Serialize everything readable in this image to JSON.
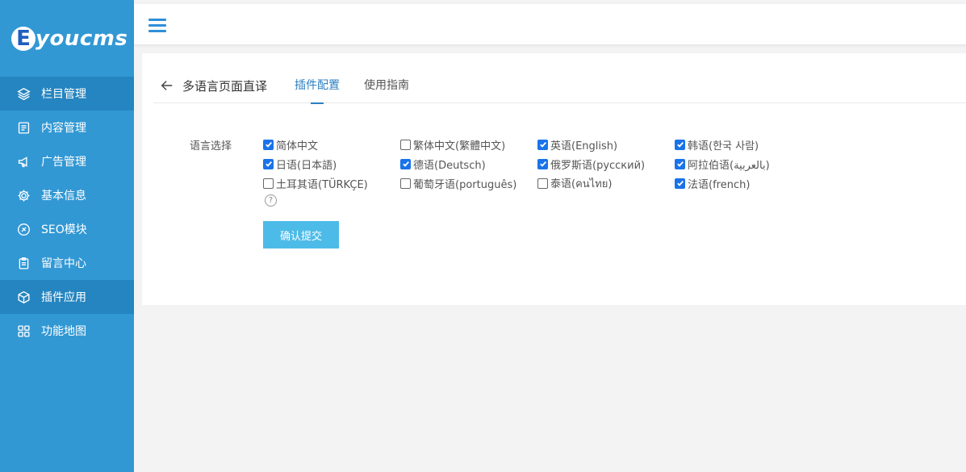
{
  "brand": {
    "mark": "E",
    "text": "youcms"
  },
  "sidebar": {
    "items": [
      {
        "label": "栏目管理",
        "icon": "layers-icon",
        "active": true
      },
      {
        "label": "内容管理",
        "icon": "document-icon",
        "active": false
      },
      {
        "label": "广告管理",
        "icon": "megaphone-icon",
        "active": false
      },
      {
        "label": "基本信息",
        "icon": "gear-icon",
        "active": false
      },
      {
        "label": "SEO模块",
        "icon": "seo-icon",
        "active": false
      },
      {
        "label": "留言中心",
        "icon": "clipboard-icon",
        "active": false
      },
      {
        "label": "插件应用",
        "icon": "cube-icon",
        "active": true
      },
      {
        "label": "功能地图",
        "icon": "grid-icon",
        "active": false
      }
    ]
  },
  "header": {
    "menu_icon": "hamburger-icon"
  },
  "page": {
    "title": "多语言页面直译",
    "tabs": [
      {
        "label": "插件配置",
        "active": true
      },
      {
        "label": "使用指南",
        "active": false
      }
    ]
  },
  "form": {
    "label": "语言选择",
    "languages": [
      [
        {
          "label": "简体中文",
          "checked": true
        },
        {
          "label": "繁体中文(繁體中文)",
          "checked": false
        },
        {
          "label": "英语(English)",
          "checked": true
        },
        {
          "label": "韩语(한국 사람)",
          "checked": true
        }
      ],
      [
        {
          "label": "日语(日本語)",
          "checked": true
        },
        {
          "label": "德语(Deutsch)",
          "checked": true
        },
        {
          "label": "俄罗斯语(русский)",
          "checked": true
        },
        {
          "label": "阿拉伯语(بالعربية)",
          "checked": true
        }
      ],
      [
        {
          "label": "土耳其语(TÜRKÇE)",
          "checked": false
        },
        {
          "label": "葡萄牙语(português)",
          "checked": false
        },
        {
          "label": "泰语(คนไทย)",
          "checked": false
        },
        {
          "label": "法语(french)",
          "checked": true
        }
      ]
    ],
    "help_symbol": "?",
    "submit_label": "确认提交"
  },
  "colors": {
    "sidebar_bg": "#3298d4",
    "sidebar_active": "#2585c0",
    "accent": "#2c7fc2",
    "submit_bg": "#4dbbe8"
  }
}
